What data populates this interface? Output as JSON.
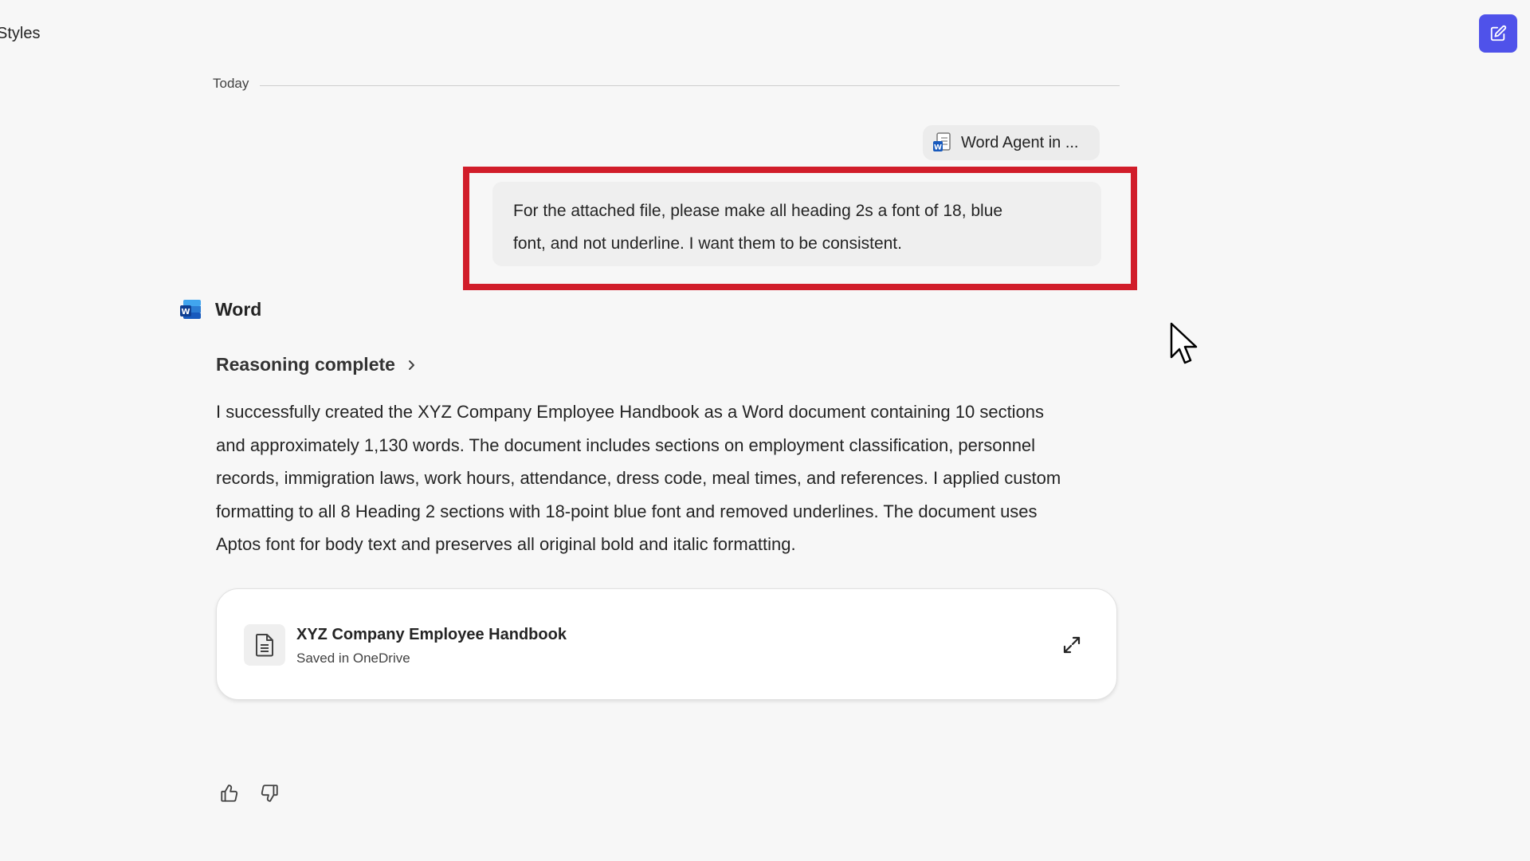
{
  "header": {
    "title": "Styles",
    "compose_icon": "edit-compose-icon"
  },
  "chat": {
    "date_divider": "Today",
    "attachment": {
      "label": "Word Agent in ...",
      "icon": "word-document-icon"
    },
    "user_message": {
      "line1": "For the attached file, please make all heading 2s a font of 18, blue",
      "line2": "font, and not underline. I want them to be consistent."
    },
    "agent": {
      "name": "Word",
      "icon": "word-app-icon",
      "reasoning_label": "Reasoning complete",
      "response": {
        "line1": "I successfully created the XYZ Company Employee Handbook as a Word document containing 10 sections",
        "line2": "and approximately 1,130 words. The document includes sections on employment classification, personnel",
        "line3": "records, immigration laws, work hours, attendance, dress code, meal times, and references. I applied custom",
        "line4": "formatting to all 8 Heading 2 sections with 18-point blue font and removed underlines. The document uses",
        "line5": "Aptos font for body text and preserves all original bold and italic formatting."
      },
      "document": {
        "title": "XYZ Company Employee Handbook",
        "subtitle": "Saved in OneDrive",
        "icon": "document-icon",
        "open_icon": "expand-icon"
      },
      "feedback": {
        "like_icon": "thumbs-up-icon",
        "dislike_icon": "thumbs-down-icon"
      }
    }
  },
  "colors": {
    "background": "#f7f7f7",
    "accent": "#4f52ea",
    "highlight": "#d11d2a"
  }
}
